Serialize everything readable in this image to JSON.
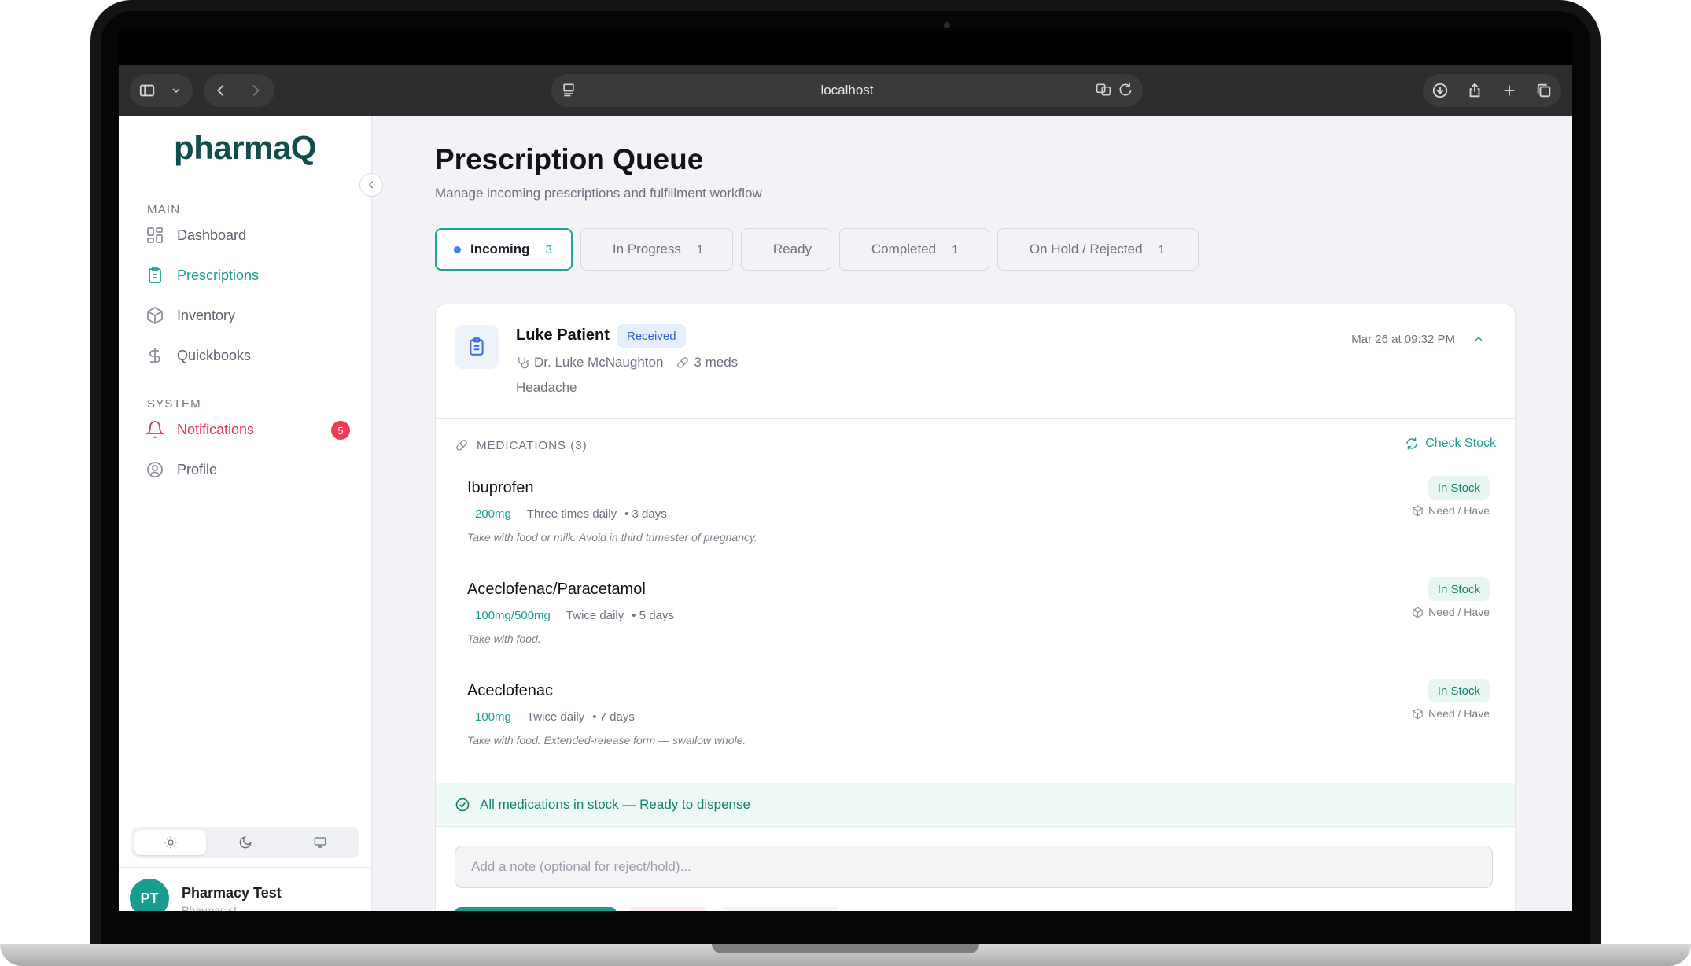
{
  "browser": {
    "url": "localhost"
  },
  "sidebar": {
    "logo": "pharmaQ",
    "sections": {
      "main_label": "MAIN",
      "system_label": "SYSTEM"
    },
    "items": [
      {
        "label": "Dashboard",
        "icon": "dashboard-icon",
        "active": false
      },
      {
        "label": "Prescriptions",
        "icon": "clipboard-icon",
        "active": true
      },
      {
        "label": "Inventory",
        "icon": "box-icon",
        "active": false
      },
      {
        "label": "Quickbooks",
        "icon": "dollar-icon",
        "active": false
      },
      {
        "label": "Notifications",
        "icon": "bell-icon",
        "badge": "5"
      },
      {
        "label": "Profile",
        "icon": "user-circle-icon",
        "active": false
      }
    ],
    "theme_options": [
      "light",
      "dark",
      "system"
    ],
    "theme_selected": "light",
    "user": {
      "initials": "PT",
      "name": "Pharmacy Test",
      "role": "Pharmacist"
    }
  },
  "page": {
    "title": "Prescription Queue",
    "subtitle": "Manage incoming prescriptions and fulfillment workflow"
  },
  "tabs": [
    {
      "label": "Incoming",
      "count": "3",
      "active": true
    },
    {
      "label": "In Progress",
      "count": "1"
    },
    {
      "label": "Ready",
      "count": ""
    },
    {
      "label": "Completed",
      "count": "1"
    },
    {
      "label": "On Hold / Rejected",
      "count": "1"
    }
  ],
  "prescription": {
    "patient": "Luke Patient",
    "status": "Received",
    "doctor": "Dr. Luke McNaughton",
    "meds_count": "3 meds",
    "diagnosis": "Headache",
    "timestamp": "Mar 26 at 09:32 PM",
    "medications_header": "MEDICATIONS (3)",
    "check_stock_label": "Check Stock",
    "medications": [
      {
        "name": "Ibuprofen",
        "dose": "200mg",
        "frequency": "Three times daily",
        "duration": "• 3 days",
        "note": "Take with food or milk. Avoid in third trimester of pregnancy.",
        "stock": "In Stock",
        "need_have": "Need / Have"
      },
      {
        "name": "Aceclofenac/Paracetamol",
        "dose": "100mg/500mg",
        "frequency": "Twice daily",
        "duration": "• 5 days",
        "note": "Take with food.",
        "stock": "In Stock",
        "need_have": "Need / Have"
      },
      {
        "name": "Aceclofenac",
        "dose": "100mg",
        "frequency": "Twice daily",
        "duration": "• 7 days",
        "note": "Take with food. Extended-release form — swallow whole.",
        "stock": "In Stock",
        "need_have": "Need / Have"
      }
    ],
    "ready_message": "All medications in stock — Ready to dispense",
    "note_placeholder": "Add a note (optional for reject/hold)..."
  },
  "colors": {
    "accent": "#1a9e8f",
    "alert": "#ef3b55",
    "received": "#3566d4"
  }
}
